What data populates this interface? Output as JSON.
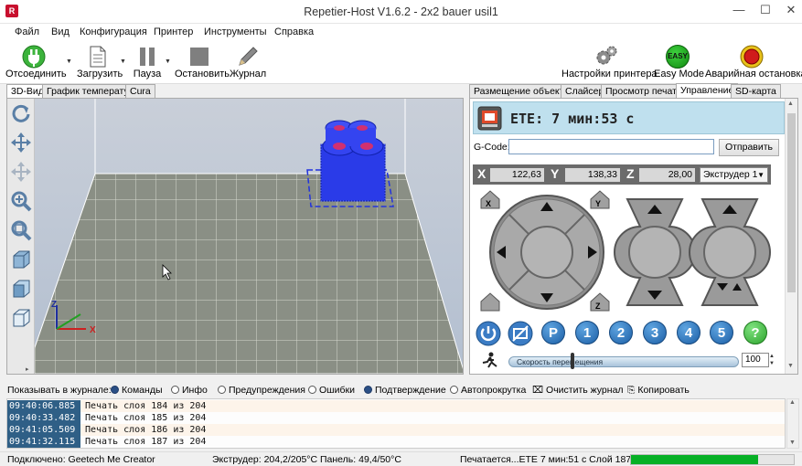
{
  "window": {
    "title": "Repetier-Host V1.6.2 - 2x2 bauer usil1",
    "icon_letter": "R"
  },
  "menu": [
    "Файл",
    "Вид",
    "Конфигурация",
    "Принтер",
    "Инструменты",
    "Справка"
  ],
  "toolbar": {
    "disconnect": "Отсоединить",
    "load": "Загрузить",
    "pause": "Пауза",
    "stop": "Остановить",
    "log": "Журнал",
    "printer_settings": "Настройки принтера",
    "easy_mode": "Easy Mode",
    "easy_badge": "EASY",
    "emergency": "Аварийная остановка"
  },
  "left_tabs": [
    "3D-Вид",
    "График температур",
    "Cura"
  ],
  "right_tabs": [
    "Размещение объекта",
    "Слайсер",
    "Просмотр печати",
    "Управление",
    "SD-карта"
  ],
  "viewport": {
    "axis_x": "X",
    "axis_z": "Z"
  },
  "control": {
    "ete": "ETE: 7 мин:53 с",
    "gcode_label": "G-Code:",
    "gcode_value": "",
    "send": "Отправить",
    "x_label": "X",
    "x_value": "122,63",
    "y_label": "Y",
    "y_value": "138,33",
    "z_label": "Z",
    "z_value": "28,00",
    "extruder": "Экструдер 1",
    "home_x": "X",
    "home_y": "Y",
    "home_z": "Z",
    "btn_p": "P",
    "num_buttons": [
      "1",
      "2",
      "3",
      "4",
      "5"
    ],
    "help": "?",
    "speed_label": "Скорость перемещения",
    "speed_value": "100"
  },
  "log_toolbar": {
    "show_label": "Показывать в журнале:",
    "commands": "Команды",
    "info": "Инфо",
    "warnings": "Предупреждения",
    "errors": "Ошибки",
    "ack": "Подтверждение",
    "autoscroll": "Автопрокрутка",
    "clear": "Очистить журнал",
    "copy": "Копировать"
  },
  "log": [
    {
      "time": "09:40:06.885",
      "msg": "Печать слоя 184 из 204"
    },
    {
      "time": "09:40:33.482",
      "msg": "Печать слоя 185 из 204"
    },
    {
      "time": "09:41:05.509",
      "msg": "Печать слоя 186 из 204"
    },
    {
      "time": "09:41:32.115",
      "msg": "Печать слоя 187 из 204"
    }
  ],
  "status": {
    "connected": "Подключено: Geetech Me Creator",
    "temps": "Экструдер: 204,2/205°C Панель: 49,4/50°C",
    "printing": "Печатается...ETE 7 мин:51 с Слой 187/204",
    "progress_fraction": 0.78,
    "progress_color": "#06b025"
  },
  "colors": {
    "accent": "#2f5f86",
    "ete_bg": "#bfe0ee",
    "model": "#2233dd"
  }
}
